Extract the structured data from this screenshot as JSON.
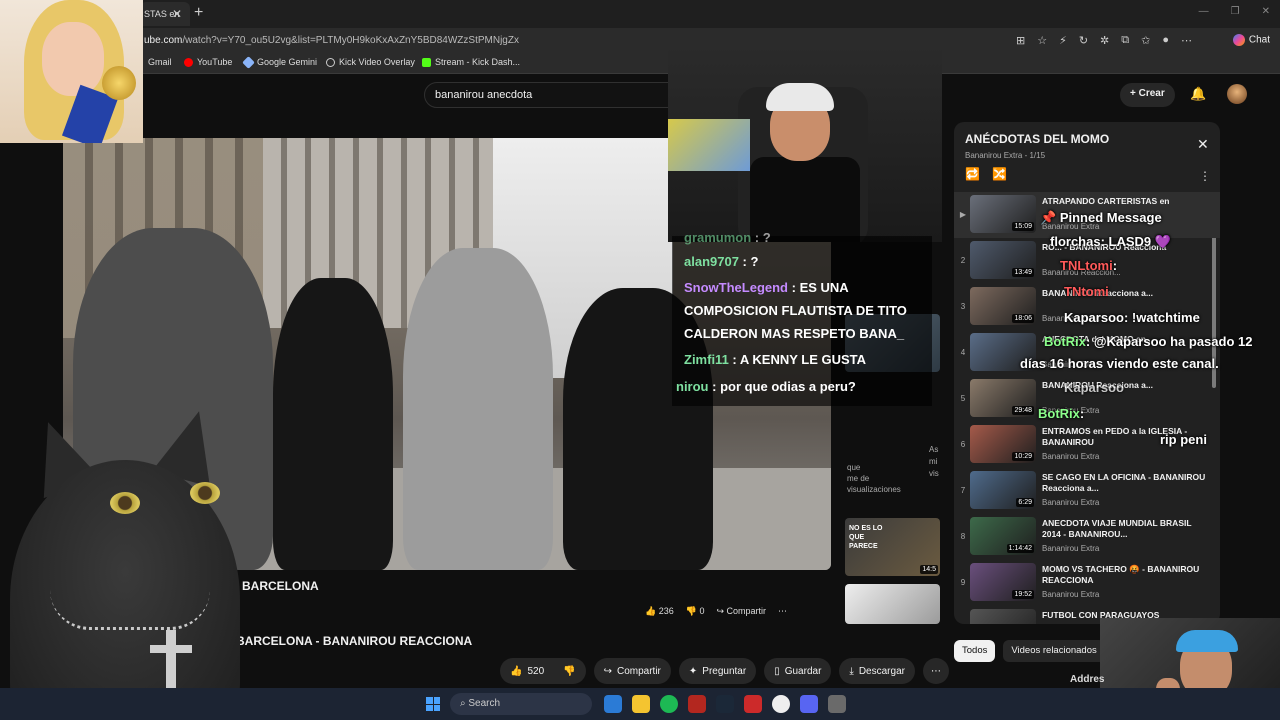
{
  "browser": {
    "tab_title": "STAS en",
    "url_prefix": "ube.com",
    "url_path": "/watch?v=Y70_ou5U2vg&list=PLTMy0H9koKxAxZnY5BD84WZzStPMNjgZx",
    "chat_label": "Chat",
    "bookmarks": [
      {
        "label": "Gmail",
        "color": "#ea4335"
      },
      {
        "label": "YouTube",
        "color": "#ff0000"
      },
      {
        "label": "Google Gemini",
        "color": "#8ab4f8"
      },
      {
        "label": "Kick Video Overlay",
        "color": "#cccccc"
      },
      {
        "label": "Stream - Kick Dash...",
        "color": "#53fc18"
      }
    ]
  },
  "header": {
    "search_value": "bananirou anecdota",
    "create_label": "Crear"
  },
  "video": {
    "title_partial": "N BARCELONA",
    "likes_small": "236",
    "dislikes_small": "0",
    "share_small": "Compartir",
    "main_title": "BARCELONA - BANANIROU REACCIONA",
    "likes": "520",
    "actions": {
      "share": "Compartir",
      "ask": "Preguntar",
      "save": "Guardar",
      "download": "Descargar"
    }
  },
  "stream_chat": [
    {
      "user": "gramumon",
      "text": "?"
    },
    {
      "user": "alan9707",
      "text": "?"
    },
    {
      "user": "SnowTheLegend",
      "text": "ES UNA"
    },
    {
      "user": "",
      "text": "COMPOSICION FLAUTISTA DE TITO"
    },
    {
      "user": "",
      "text": "CALDERON MAS RESPETO BANA_"
    },
    {
      "user": "Zimfi11",
      "text": "A KENNY LE GUSTA"
    },
    {
      "user": "nirou",
      "text": "por que odias a peru?"
    }
  ],
  "playlist": {
    "title": "ANÉCDOTAS DEL MOMO",
    "subtitle": "Bananirou Extra - 1/15",
    "items": [
      {
        "index": "▶",
        "title": "ATRAPANDO CARTERISTAS en",
        "channel": "Bananirou Extra",
        "duration": "15:09",
        "color": "#6a6f7a"
      },
      {
        "index": "2",
        "title": "RO... - BANANIROU Reacciona",
        "channel": "Bananirou Reaccion...",
        "duration": "13:49",
        "color": "#4f5a6c"
      },
      {
        "index": "3",
        "title": "BANANIROU Reacciona a...",
        "channel": "Bananirou Extra",
        "duration": "18:06",
        "color": "#7d6a5e"
      },
      {
        "index": "4",
        "title": "ANECDOTA del MOMO en...",
        "channel": "Bananirou Extra",
        "duration": "",
        "color": "#5a6d88"
      },
      {
        "index": "5",
        "title": "BANANIROU Reacciona a...",
        "channel": "Bananirou Extra",
        "duration": "29:48",
        "color": "#8a7a6a"
      },
      {
        "index": "6",
        "title": "ENTRAMOS en PEDO a la IGLESIA - BANANIROU",
        "channel": "Bananirou Extra",
        "duration": "10:29",
        "color": "#a55a4a"
      },
      {
        "index": "7",
        "title": "SE CAGO EN LA OFICINA - BANANIROU Reacciona a...",
        "channel": "Bananirou Extra",
        "duration": "6:29",
        "color": "#4f6b8c"
      },
      {
        "index": "8",
        "title": "ANECDOTA VIAJE MUNDIAL BRASIL 2014 - BANANIROU...",
        "channel": "Bananirou Extra",
        "duration": "1:14:42",
        "color": "#3d6a4a"
      },
      {
        "index": "9",
        "title": "MOMO VS TACHERO 🤬 - BANANIROU REACCIONA",
        "channel": "Bananirou Extra",
        "duration": "19:52",
        "color": "#6a4f7d"
      },
      {
        "index": "",
        "title": "FUTBOL CON PARAGUAYOS",
        "channel": "",
        "duration": "",
        "color": "#555555"
      }
    ]
  },
  "pinned_chat": [
    {
      "user": "",
      "text": "Pinned Message"
    },
    {
      "user": "florchas",
      "text": "LASD9 💜"
    },
    {
      "user": "TNLtomi",
      "text": ""
    },
    {
      "user": "TNtomi",
      "text": ""
    },
    {
      "user": "",
      "text": "Kaparsoo: !watchtime"
    },
    {
      "user": "BotRix",
      "text": "@Kaparsoo ha pasado 12"
    },
    {
      "user": "",
      "text": "días 16 horas viendo este canal."
    },
    {
      "user": "Kaparsoo",
      "text": ""
    },
    {
      "user": "BotRix",
      "text": ""
    },
    {
      "user": "",
      "text": "rip peni"
    }
  ],
  "filters": {
    "all": "Todos",
    "related": "Videos relacionados"
  },
  "rec_text": {
    "line1": "que",
    "line2": "me de",
    "line3": "visualizaciones",
    "thumb_text": "NO ES LO QUE PARECE",
    "dur1": "14:5"
  },
  "side_letters": {
    "a": "As",
    "b": "mi",
    "c": "vis"
  },
  "address_label": "Addres",
  "taskbar": {
    "search_placeholder": "Search"
  }
}
